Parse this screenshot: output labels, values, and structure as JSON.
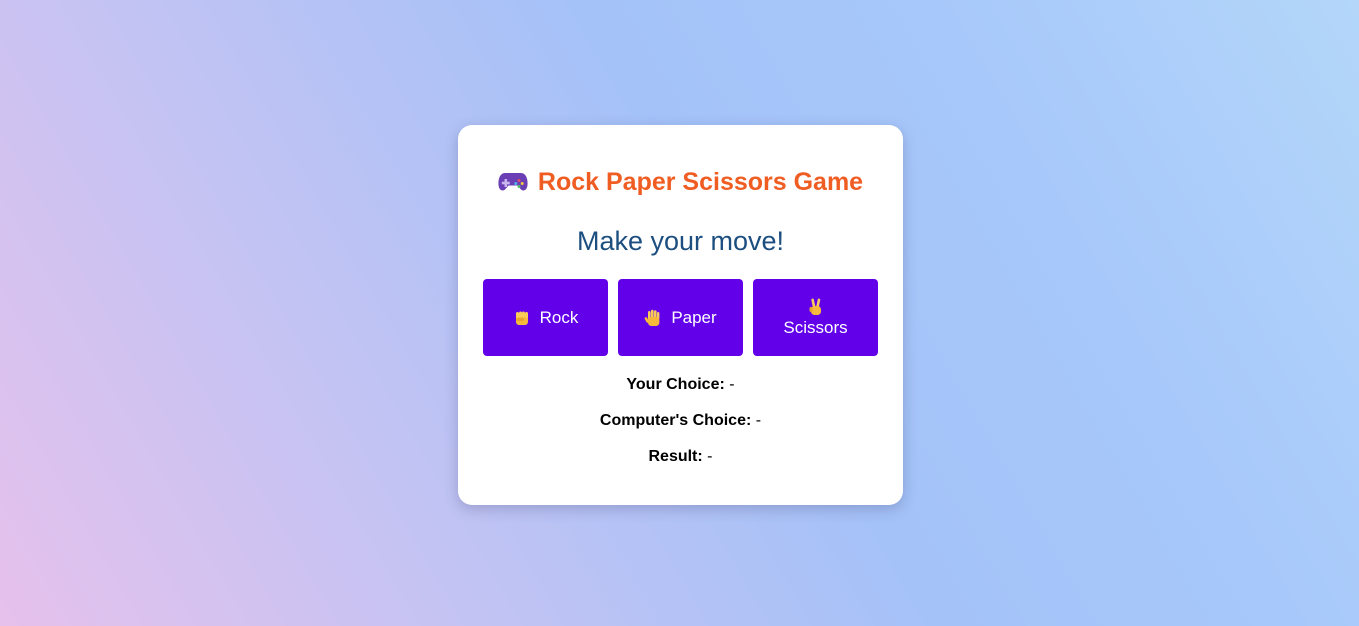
{
  "game": {
    "title": "Rock Paper Scissors Game",
    "title_icon": "gamepad-icon",
    "prompt": "Make your move!",
    "colors": {
      "title": "#f05d23",
      "prompt": "#1c4e80",
      "button_bg": "#6200ea",
      "button_text": "#ffffff"
    },
    "choices": [
      {
        "label": "Rock",
        "icon": "raised-fist-icon"
      },
      {
        "label": "Paper",
        "icon": "raised-hand-icon"
      },
      {
        "label": "Scissors",
        "icon": "victory-hand-icon"
      }
    ],
    "status": {
      "your_choice_label": "Your Choice:",
      "your_choice_value": "-",
      "computer_choice_label": "Computer's Choice:",
      "computer_choice_value": "-",
      "result_label": "Result:",
      "result_value": "-"
    }
  }
}
